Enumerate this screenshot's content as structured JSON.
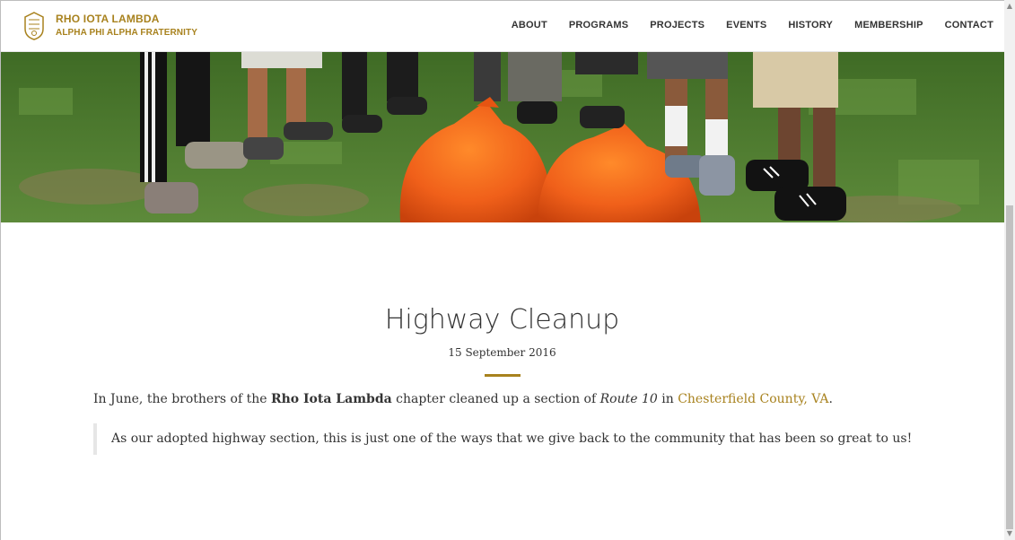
{
  "brand": {
    "line1": "RHO IOTA LAMBDA",
    "line2": "ALPHA PHI ALPHA FRATERNITY",
    "accent_color": "#a8821e"
  },
  "nav": [
    "ABOUT",
    "PROGRAMS",
    "PROJECTS",
    "EVENTS",
    "HISTORY",
    "MEMBERSHIP",
    "CONTACT"
  ],
  "post": {
    "title": "Highway Cleanup",
    "date": "15 September 2016",
    "para_prefix": "In June, the brothers of the ",
    "para_chapter": "Rho Iota Lambda",
    "para_middle": " chapter cleaned up a section of ",
    "para_route": "Route 10",
    "para_in": " in ",
    "para_link": "Chesterfield County, VA",
    "para_end": ".",
    "quote": "As our adopted highway section, this is just one of the ways that we give back to the community that has been so great to us!"
  },
  "scrollbar": {
    "up_glyph": "▲",
    "down_glyph": "▼"
  }
}
